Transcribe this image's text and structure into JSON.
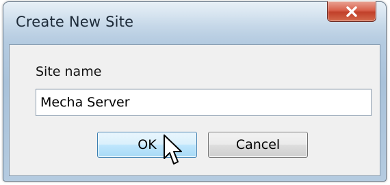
{
  "dialog": {
    "title": "Create New Site",
    "close_icon": "close-x-icon",
    "site_name_label": "Site name",
    "site_name_value": "Mecha Server",
    "ok_label": "OK",
    "cancel_label": "Cancel"
  },
  "colors": {
    "title_bar": "#b7cde2",
    "close_button": "#c1402a",
    "client_bg": "#f0f0f0",
    "ok_button": "#bee6fd"
  },
  "pointer_icon": "arrow-cursor-icon"
}
